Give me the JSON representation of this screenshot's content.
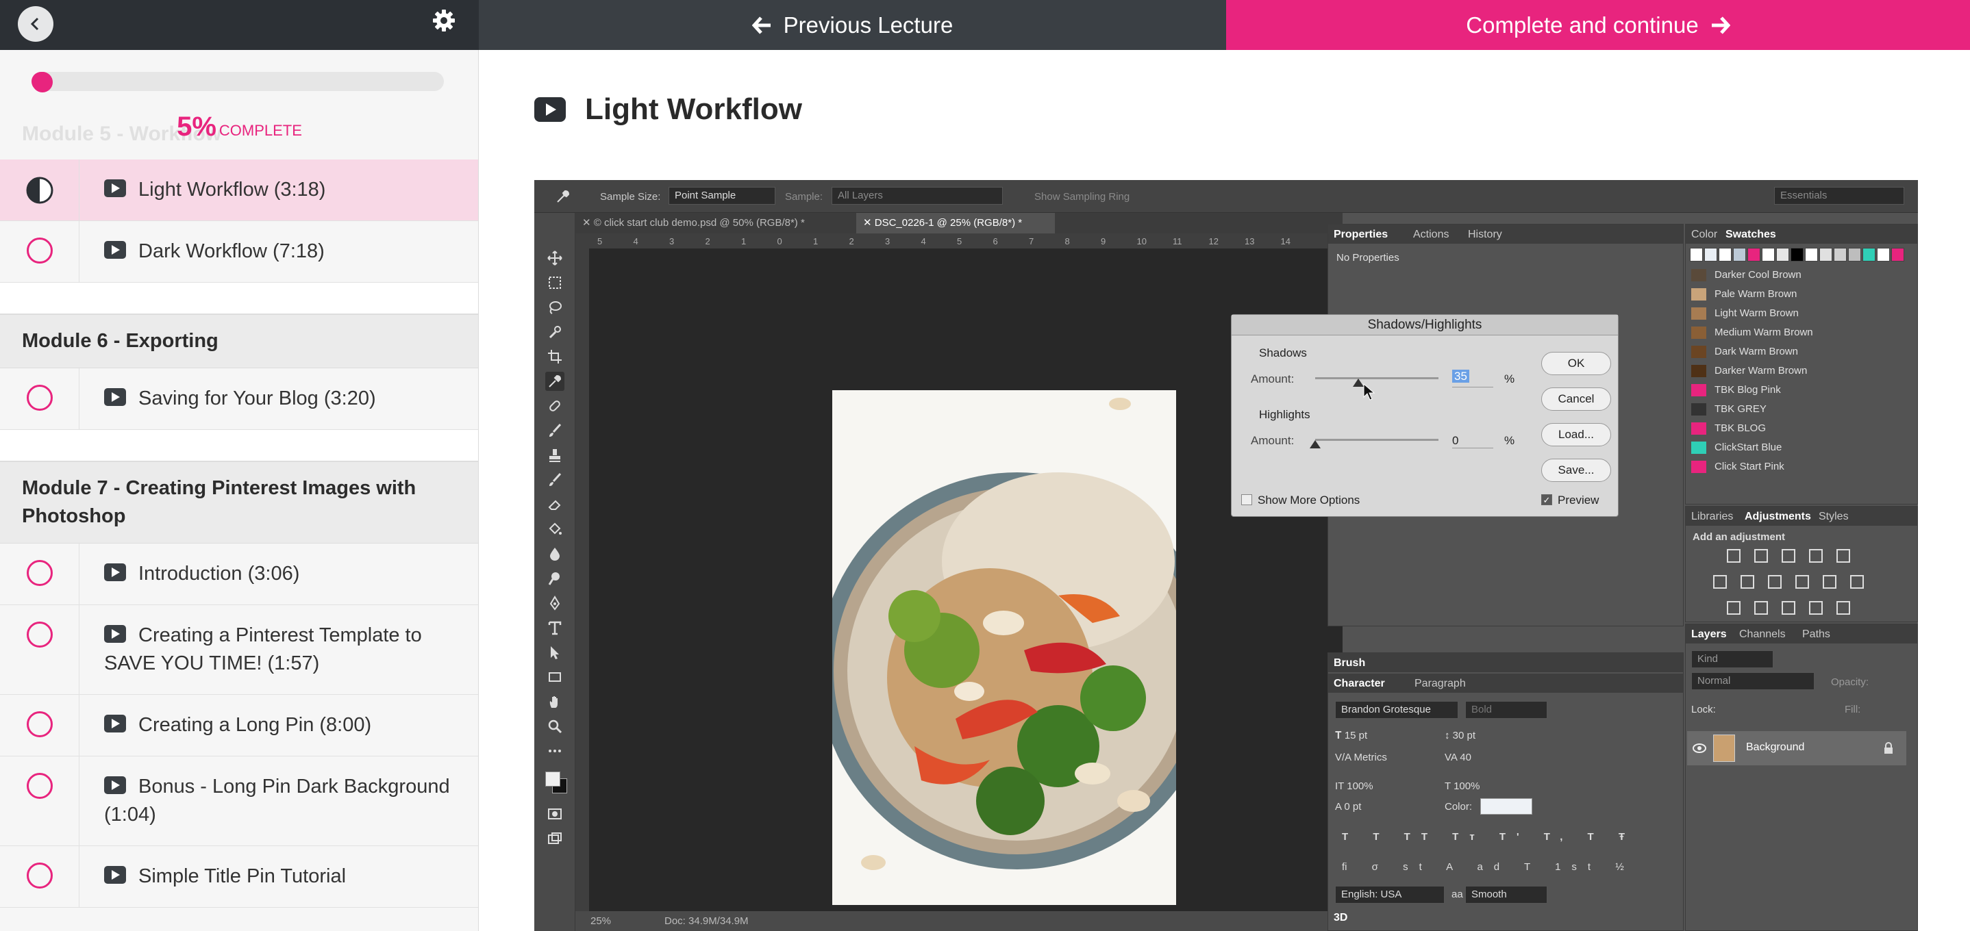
{
  "topbar": {
    "previous_label": "Previous Lecture",
    "complete_label": "Complete and continue"
  },
  "progress": {
    "percent": 5,
    "percent_text": "5%",
    "complete_label": "COMPLETE"
  },
  "sidebar": {
    "ghost_module": "Module 5 - Workflow",
    "sections": [
      {
        "kind": "lesson",
        "label": "Light Workflow (3:18)",
        "status": "in-progress",
        "active": true
      },
      {
        "kind": "lesson",
        "label": "Dark Workflow (7:18)",
        "status": "incomplete",
        "active": false
      },
      {
        "kind": "module",
        "label": "Module 6 - Exporting"
      },
      {
        "kind": "lesson",
        "label": "Saving for Your Blog (3:20)",
        "status": "incomplete",
        "active": false
      },
      {
        "kind": "module",
        "label": "Module 7 - Creating Pinterest Images with Photoshop"
      },
      {
        "kind": "lesson",
        "label": "Introduction (3:06)",
        "status": "incomplete",
        "active": false
      },
      {
        "kind": "lesson",
        "label": "Creating a Pinterest Template to SAVE YOU TIME! (1:57)",
        "status": "incomplete",
        "active": false
      },
      {
        "kind": "lesson",
        "label": "Creating a Long Pin (8:00)",
        "status": "incomplete",
        "active": false
      },
      {
        "kind": "lesson",
        "label": "Bonus - Long Pin Dark Background (1:04)",
        "status": "incomplete",
        "active": false
      },
      {
        "kind": "lesson",
        "label": "Simple Title Pin Tutorial",
        "status": "incomplete",
        "active": false
      }
    ]
  },
  "lecture": {
    "title": "Light Workflow"
  },
  "photoshop": {
    "options": {
      "sample_size_label": "Sample Size:",
      "sample_size_value": "Point Sample",
      "sample_label": "Sample:",
      "sample_value": "All Layers",
      "ring_label": "Show Sampling Ring",
      "workspace": "Essentials"
    },
    "doc_tabs": [
      "© click start club demo.psd @ 50% (RGB/8*) *",
      "DSC_0226-1 @ 25% (RGB/8*) *"
    ],
    "ruler_numbers": [
      "5",
      "4",
      "3",
      "2",
      "1",
      "0",
      "1",
      "2",
      "3",
      "4",
      "5",
      "6",
      "7",
      "8",
      "9",
      "10",
      "11",
      "12",
      "13",
      "14"
    ],
    "status": {
      "zoom": "25%",
      "doc": "Doc: 34.9M/34.9M"
    },
    "properties": {
      "tabs": [
        "Properties",
        "Actions",
        "History"
      ],
      "content": "No Properties"
    },
    "color_panel": {
      "tabs": [
        "Color",
        "Swatches"
      ],
      "top_swatches": [
        "#ffffff",
        "#e9eef4",
        "#ffffff",
        "#bcc9d6",
        "#e8247e",
        "#ffffff",
        "#e6e6e6",
        "#000000",
        "#ffffff",
        "#e0e0e0",
        "#cfcfcf",
        "#bdbdbd",
        "#2fcfb6",
        "#ffffff",
        "#e8247e"
      ],
      "swatches": [
        {
          "name": "Darker Cool Brown",
          "color": "#5a4a3a"
        },
        {
          "name": "Pale Warm Brown",
          "color": "#c9a47a"
        },
        {
          "name": "Light Warm Brown",
          "color": "#a77c52"
        },
        {
          "name": "Medium Warm Brown",
          "color": "#8a5f36"
        },
        {
          "name": "Dark Warm Brown",
          "color": "#6b4523"
        },
        {
          "name": "Darker Warm Brown",
          "color": "#4f3116"
        },
        {
          "name": "TBK Blog Pink",
          "color": "#e8247e"
        },
        {
          "name": "TBK GREY",
          "color": "#333333"
        },
        {
          "name": "TBK BLOG",
          "color": "#e8247e"
        },
        {
          "name": "ClickStart Blue",
          "color": "#2fcfb6"
        },
        {
          "name": "Click Start Pink",
          "color": "#e8247e"
        }
      ]
    },
    "adjustments": {
      "tabs": [
        "Libraries",
        "Adjustments",
        "Styles"
      ],
      "label": "Add an adjustment"
    },
    "layers": {
      "tabs": [
        "Layers",
        "Channels",
        "Paths"
      ],
      "kind": "Kind",
      "blend": "Normal",
      "opacity_label": "Opacity:",
      "lock_label": "Lock:",
      "fill_label": "Fill:",
      "layer_name": "Background"
    },
    "brush_tab": "Brush",
    "character": {
      "tabs": [
        "Character",
        "Paragraph"
      ],
      "font": "Brandon Grotesque",
      "style": "Bold",
      "size": "15 pt",
      "leading": "30 pt",
      "kerning": "Metrics",
      "tracking": "40",
      "vscale": "100%",
      "hscale": "100%",
      "baseline": "0 pt",
      "color_label": "Color:",
      "language": "English: USA",
      "aa_label": "aa",
      "aa_value": "Smooth",
      "bottom_tab": "3D"
    },
    "dialog": {
      "title": "Shadows/Highlights",
      "shadows_label": "Shadows",
      "highlights_label": "Highlights",
      "amount_label": "Amount:",
      "shadows_amount": "35",
      "highlights_amount": "0",
      "unit": "%",
      "show_more": "Show More Options",
      "preview": "Preview",
      "ok": "OK",
      "cancel": "Cancel",
      "load": "Load...",
      "save": "Save..."
    }
  }
}
